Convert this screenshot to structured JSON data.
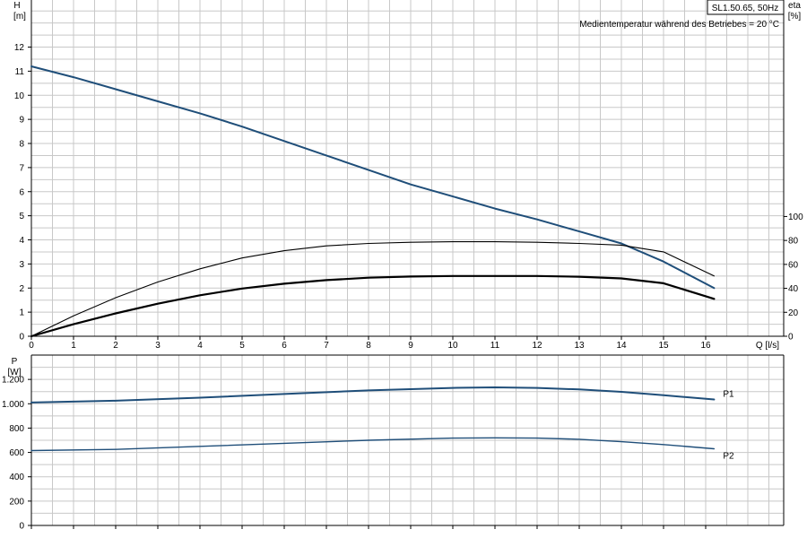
{
  "pump_label": "SL1.50.65, 50Hz",
  "temperature_note": "Medientemperatur während des Betriebes = 20 °C",
  "chart_data": [
    {
      "type": "line",
      "ylabel_symbol": "H",
      "ylabel_unit": "[m]",
      "y2label_symbol": "eta",
      "y2label_unit": "[%]",
      "xlabel": "Q [l/s]",
      "xlim": [
        0,
        17.5
      ],
      "ylim": [
        0,
        13
      ],
      "y2lim": [
        0,
        100
      ],
      "x_ticks": [
        0,
        1,
        2,
        3,
        4,
        5,
        6,
        7,
        8,
        9,
        10,
        11,
        12,
        13,
        14,
        15,
        16
      ],
      "y_ticks": [
        0,
        1,
        2,
        3,
        4,
        5,
        6,
        7,
        8,
        9,
        10,
        11,
        12
      ],
      "y2_ticks": [
        0,
        20,
        40,
        60,
        80,
        100
      ],
      "grid": true,
      "series": [
        {
          "axis": "left",
          "color": "#1f4e79",
          "x": [
            0,
            1,
            2,
            3,
            4,
            5,
            6,
            7,
            8,
            9,
            10,
            11,
            12,
            13,
            14,
            15,
            16.2
          ],
          "y": [
            11.2,
            10.75,
            10.25,
            9.75,
            9.25,
            8.7,
            8.1,
            7.5,
            6.9,
            6.3,
            5.8,
            5.3,
            4.85,
            4.35,
            3.85,
            3.1,
            2.0
          ]
        },
        {
          "axis": "left",
          "color": "#000000",
          "x": [
            0,
            1,
            2,
            3,
            4,
            5,
            6,
            7,
            8,
            9,
            10,
            11,
            12,
            13,
            14,
            15,
            16.2
          ],
          "y": [
            0,
            0.85,
            1.6,
            2.25,
            2.8,
            3.25,
            3.55,
            3.75,
            3.85,
            3.9,
            3.92,
            3.92,
            3.9,
            3.85,
            3.78,
            3.5,
            2.5
          ]
        },
        {
          "axis": "left",
          "color": "#000000",
          "x": [
            0,
            1,
            2,
            3,
            4,
            5,
            6,
            7,
            8,
            9,
            10,
            11,
            12,
            13,
            14,
            15,
            16.2
          ],
          "y": [
            0,
            0.5,
            0.95,
            1.35,
            1.7,
            1.98,
            2.18,
            2.33,
            2.43,
            2.48,
            2.5,
            2.5,
            2.5,
            2.47,
            2.4,
            2.2,
            1.55
          ]
        }
      ]
    },
    {
      "type": "line",
      "ylabel_symbol": "P",
      "ylabel_unit": "[W]",
      "xlim": [
        0,
        17.5
      ],
      "ylim": [
        0,
        1400
      ],
      "y_ticks": [
        0,
        200,
        400,
        600,
        800,
        1000,
        1200
      ],
      "y_tick_labels": [
        "0",
        "200",
        "400",
        "600",
        "800",
        "1.000",
        "1.200"
      ],
      "grid": true,
      "series": [
        {
          "name": "P1",
          "color": "#1f4e79",
          "x": [
            0,
            2,
            4,
            6,
            8,
            10,
            11,
            12,
            13,
            14,
            15,
            16.2
          ],
          "y": [
            1010,
            1025,
            1050,
            1080,
            1110,
            1130,
            1135,
            1130,
            1118,
            1098,
            1070,
            1035
          ]
        },
        {
          "name": "P2",
          "color": "#1f4e79",
          "x": [
            0,
            2,
            4,
            6,
            8,
            10,
            11,
            12,
            13,
            14,
            15,
            16.2
          ],
          "y": [
            615,
            625,
            650,
            675,
            700,
            718,
            720,
            718,
            708,
            688,
            665,
            630
          ]
        }
      ]
    }
  ]
}
